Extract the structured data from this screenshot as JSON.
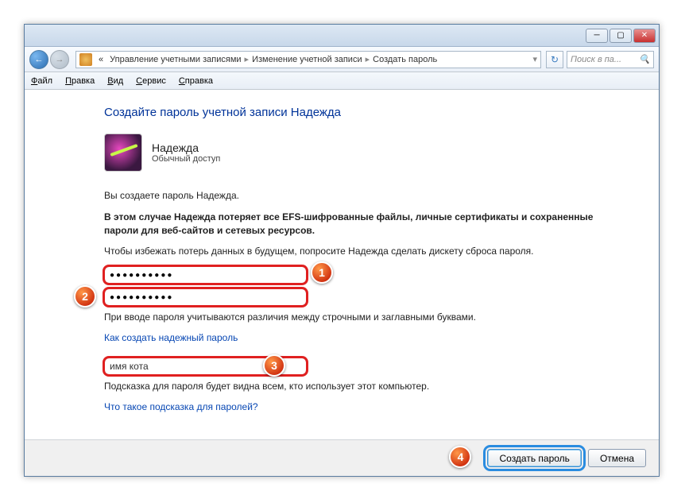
{
  "titlebar": {},
  "nav": {
    "back_label": "←",
    "fwd_label": "→",
    "crumbs": [
      "Управление учетными записями",
      "Изменение учетной записи",
      "Создать пароль"
    ],
    "search_placeholder": "Поиск в па..."
  },
  "menubar": {
    "file": "Файл",
    "edit": "Правка",
    "view": "Вид",
    "tools": "Сервис",
    "help": "Справка"
  },
  "main": {
    "heading": "Создайте пароль учетной записи Надежда",
    "user_name": "Надежда",
    "user_role": "Обычный доступ",
    "intro": "Вы создаете пароль Надежда.",
    "warning": "В этом случае Надежда потеряет все EFS-шифрованные файлы, личные сертификаты и сохраненные пароли для веб-сайтов и сетевых ресурсов.",
    "advice": "Чтобы избежать потерь данных в будущем, попросите Надежда сделать дискету сброса пароля.",
    "pw1_value": "●●●●●●●●●●",
    "pw2_value": "●●●●●●●●●●",
    "case_note": "При вводе пароля учитываются различия между строчными и заглавными буквами.",
    "link_strong": "Как создать надежный пароль",
    "hint_value": "имя кота",
    "hint_note": "Подсказка для пароля будет видна всем, кто использует этот компьютер.",
    "link_hint": "Что такое подсказка для паролей?"
  },
  "footer": {
    "create": "Создать пароль",
    "cancel": "Отмена"
  },
  "markers": {
    "m1": "1",
    "m2": "2",
    "m3": "3",
    "m4": "4"
  }
}
